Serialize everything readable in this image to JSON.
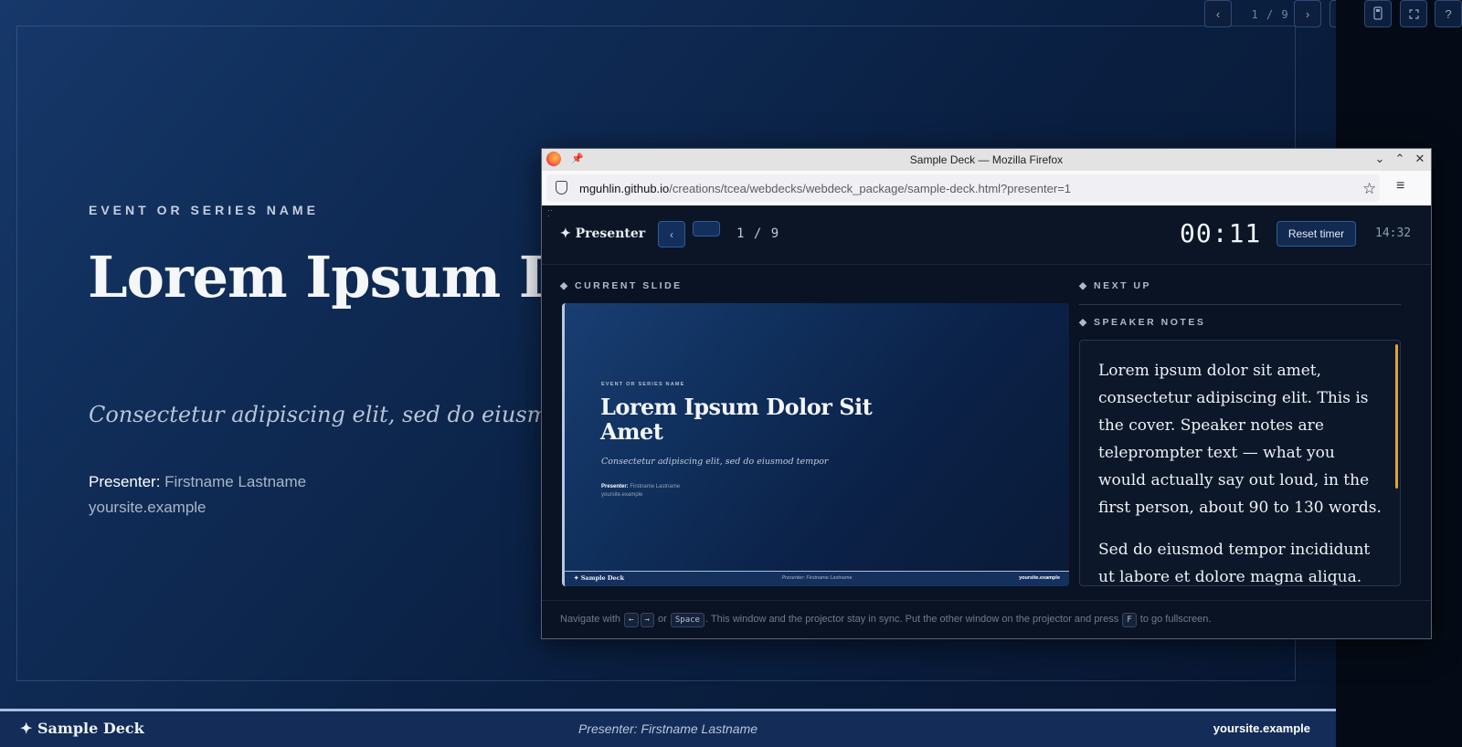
{
  "deck": {
    "event_name": "EVENT OR SERIES NAME",
    "title": "Lorem Ipsum Dolor Sit Amet",
    "subtitle": "Consectetur adipiscing elit, sed do eiusmod tempor",
    "presenter_label": "Presenter:",
    "presenter_name": "Firstname Lastname",
    "site": "yoursite.example",
    "footer": {
      "brand": "✦ Sample Deck",
      "presenter": "Presenter: Firstname Lastname",
      "site": "yoursite.example"
    },
    "controls": {
      "prev": "‹",
      "counter": "1 / 9",
      "next": "›",
      "notes_icon": "notes-icon",
      "remote_icon": "remote-icon",
      "fullscreen_icon": "fullscreen-icon",
      "help": "?"
    }
  },
  "firefox": {
    "window_title": "Sample Deck — Mozilla Firefox",
    "url_host": "mguhlin.github.io",
    "url_path": "/creations/tcea/webdecks/webdeck_package/sample-deck.html?presenter=1",
    "controls": {
      "minimize": "⌄",
      "maximize": "⌃",
      "close": "✕"
    }
  },
  "presenter": {
    "brand": "✦ Presenter",
    "prev": "‹",
    "counter": "1 / 9",
    "timer": "00:11",
    "reset_label": "Reset timer",
    "clock": "14:32",
    "current_label": "◆ CURRENT SLIDE",
    "next_label": "◆ NEXT UP",
    "notes_label": "◆ SPEAKER NOTES",
    "thumb": {
      "event_name": "EVENT OR SERIES NAME",
      "title": "Lorem Ipsum Dolor Sit Amet",
      "subtitle": "Consectetur adipiscing elit, sed do eiusmod tempor",
      "presenter_label": "Presenter:",
      "presenter_name": "Firstname Lastname",
      "site": "yoursite.example",
      "footer_brand": "✦ Sample Deck",
      "footer_presenter": "Presenter: Firstname Lastname",
      "footer_site": "yoursite.example"
    },
    "notes": [
      "Lorem ipsum dolor sit amet, consectetur adipiscing elit. This is the cover. Speaker notes are teleprompter text — what you would actually say out loud, in the first person, about 90 to 130 words.",
      "Sed do eiusmod tempor incididunt ut labore et dolore magna aliqua."
    ],
    "hint": {
      "navigate": "Navigate with",
      "key_left": "←",
      "key_right": "→",
      "or": "or",
      "key_space": "Space",
      "sync": ". This window and the projector stay in sync. Put the other window on the projector and press",
      "key_f": "F",
      "fullscreen": "to go fullscreen."
    }
  }
}
